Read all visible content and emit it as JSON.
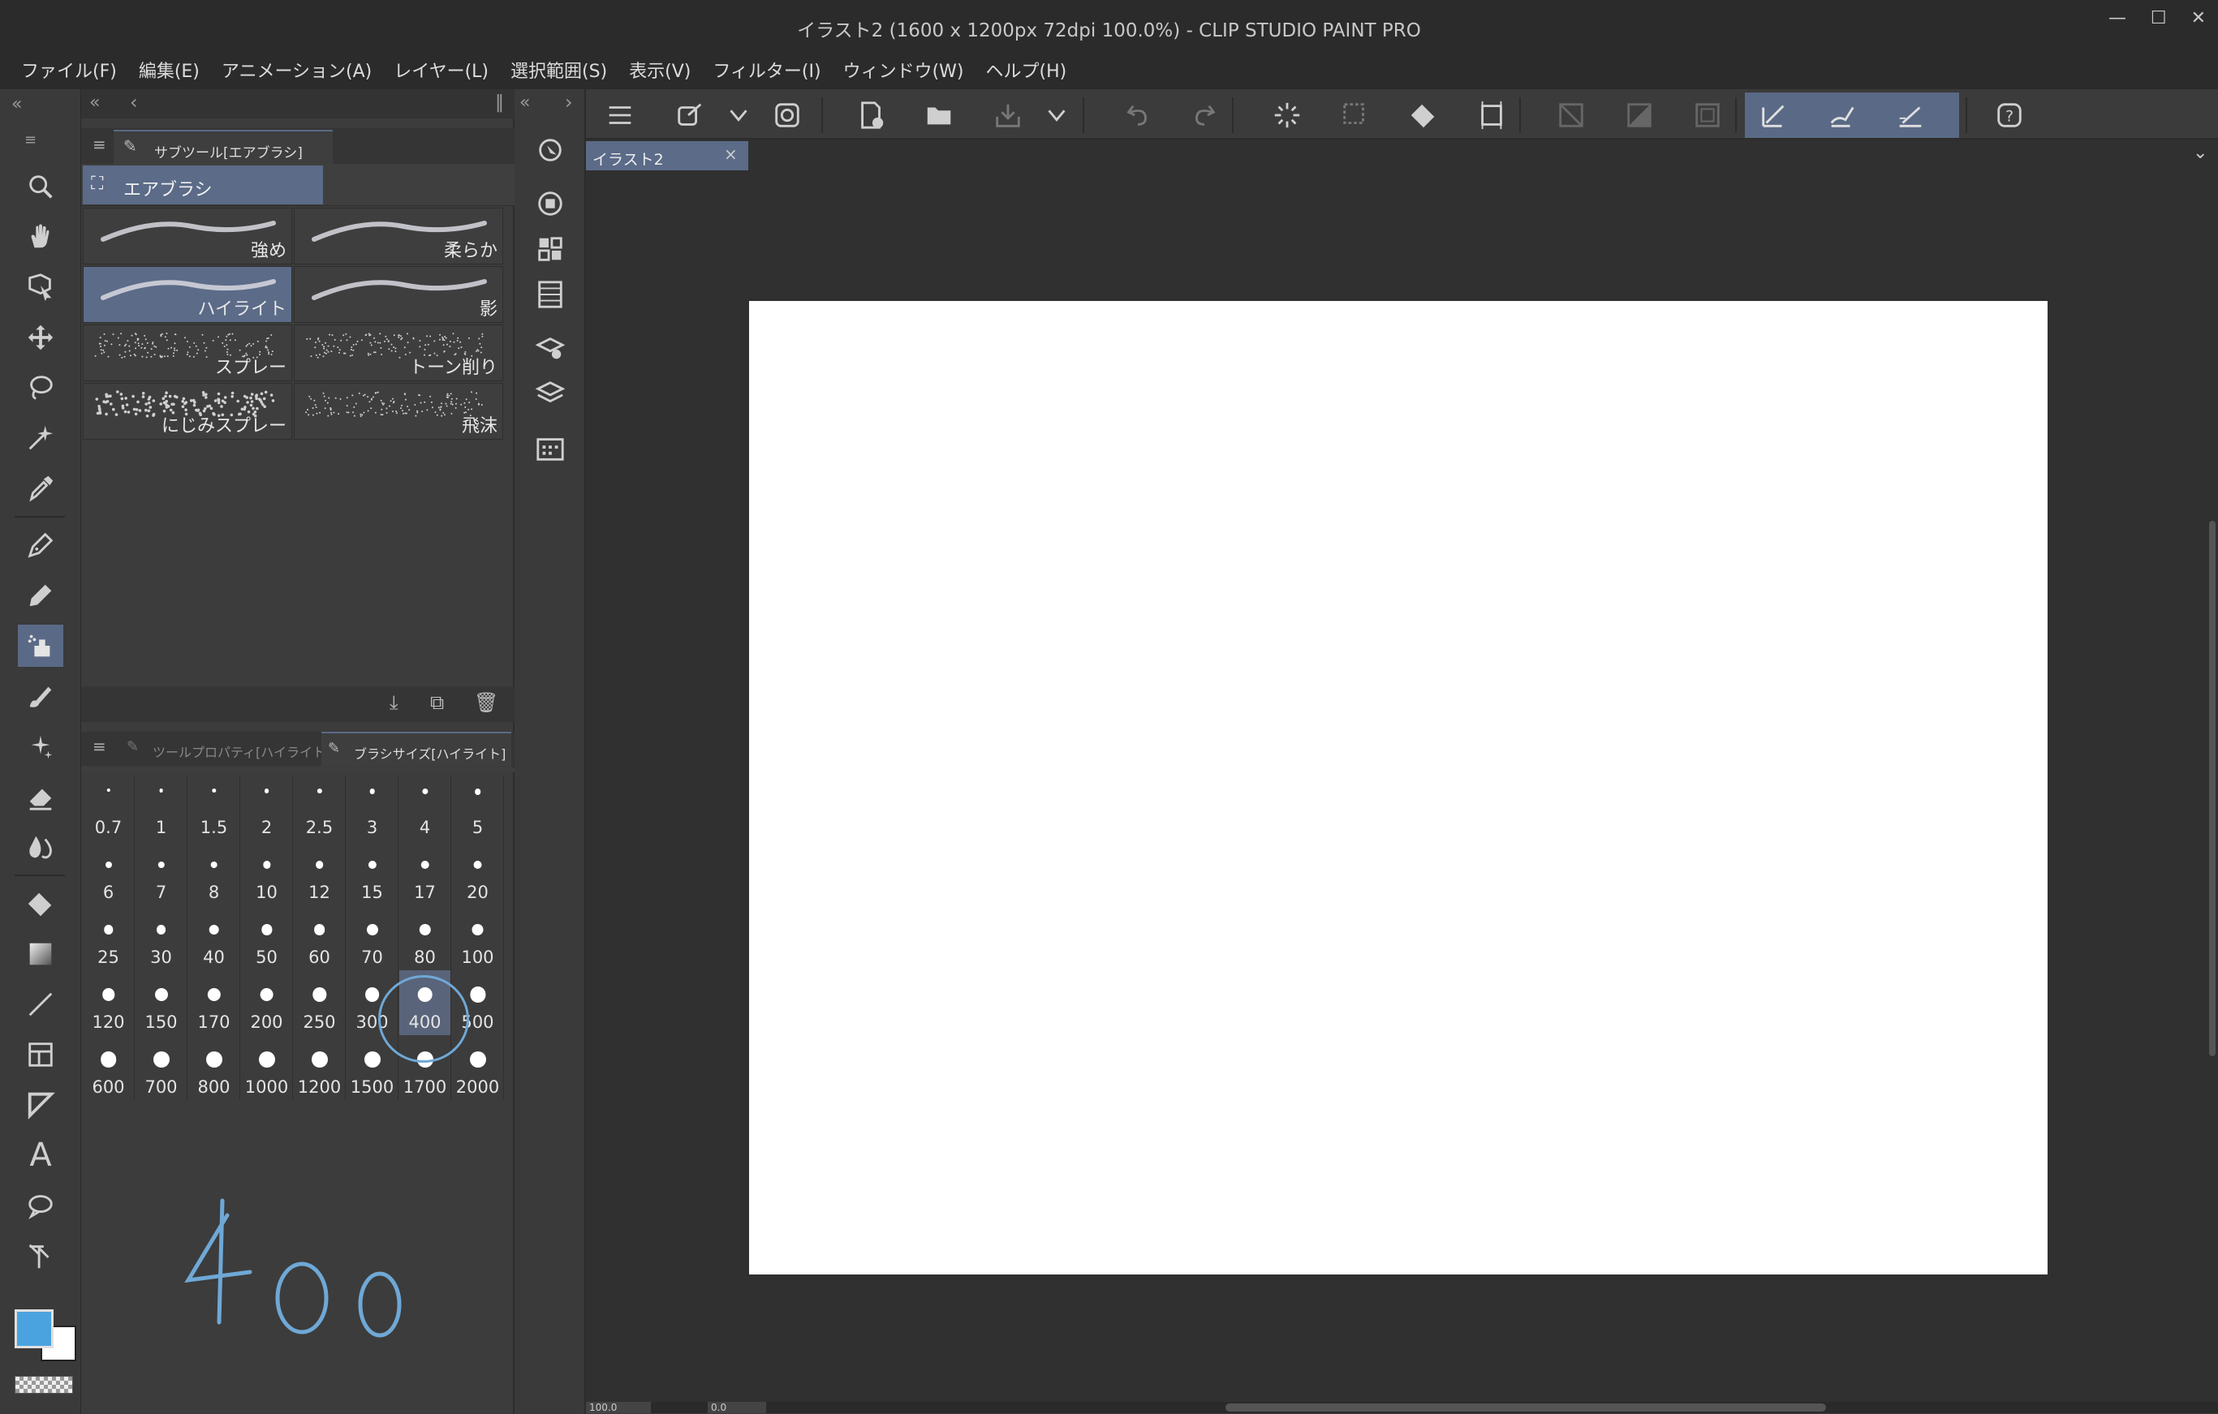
{
  "window": {
    "title": "イラスト2 (1600 x 1200px 72dpi 100.0%)  - CLIP STUDIO PAINT PRO",
    "controls": [
      "—",
      "☐",
      "✕"
    ]
  },
  "menu": [
    "ファイル(F)",
    "編集(E)",
    "アニメーション(A)",
    "レイヤー(L)",
    "選択範囲(S)",
    "表示(V)",
    "フィルター(I)",
    "ウィンドウ(W)",
    "ヘルプ(H)"
  ],
  "subtool_panel": {
    "tab": "サブツール[エアブラシ]",
    "group": "エアブラシ",
    "brushes": [
      {
        "label": "強め"
      },
      {
        "label": "柔らか"
      },
      {
        "label": "ハイライト",
        "selected": true
      },
      {
        "label": "影"
      },
      {
        "label": "スプレー"
      },
      {
        "label": "トーン削り"
      },
      {
        "label": "にじみスプレー"
      },
      {
        "label": "飛沫"
      }
    ]
  },
  "size_panel": {
    "tabs": [
      "ツールプロパティ[ハイライト]",
      "ブラシサイズ[ハイライト]"
    ],
    "sizes": [
      "0.7",
      "1",
      "1.5",
      "2",
      "2.5",
      "3",
      "4",
      "5",
      "6",
      "7",
      "8",
      "10",
      "12",
      "15",
      "17",
      "20",
      "25",
      "30",
      "40",
      "50",
      "60",
      "70",
      "80",
      "100",
      "120",
      "150",
      "170",
      "200",
      "250",
      "300",
      "400",
      "500",
      "600",
      "700",
      "800",
      "1000",
      "1200",
      "1500",
      "1700",
      "2000"
    ],
    "selected": "400",
    "handwritten_note": "400"
  },
  "canvas": {
    "tab_label": "イラスト2",
    "zoom_field": "100.0",
    "rotate_field": "0.0"
  },
  "colors": {
    "main": "#4aa3df",
    "sub": "#ffffff",
    "selected_bg": "#5a6a86",
    "annotation": "#6fa8d6"
  }
}
